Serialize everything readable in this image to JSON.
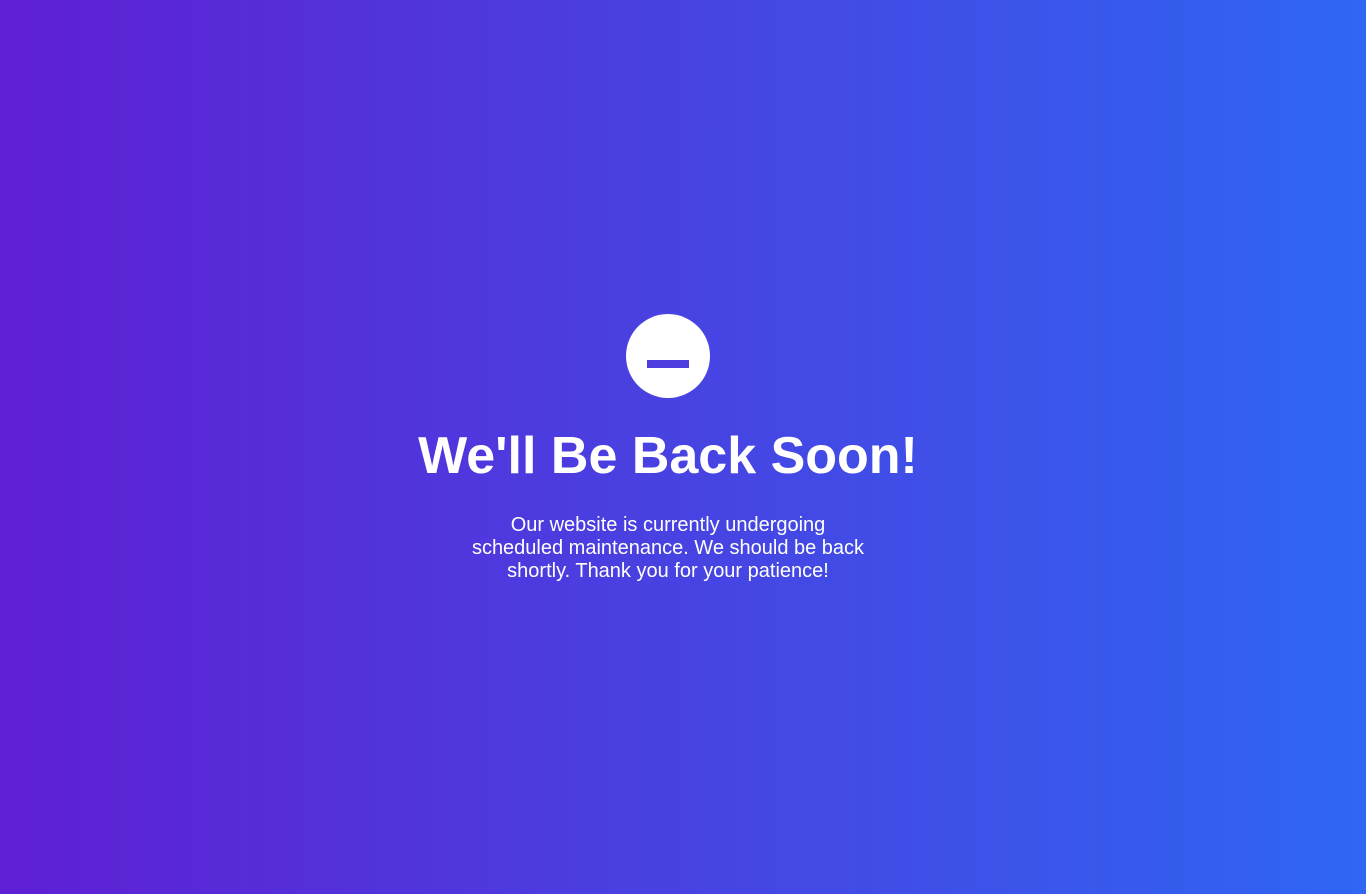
{
  "page": {
    "title": "We'll Be Back Soon!",
    "message": "Our website is currently undergoing scheduled maintenance. We should be back shortly. Thank you for your patience!",
    "icon": "minus-circle-icon"
  },
  "colors": {
    "gradient_start": "#5f1fd4",
    "gradient_mid": "#4a3fe0",
    "gradient_end": "#2f66f3",
    "icon_background": "#ffffff",
    "icon_bar": "#4f3ee0",
    "text": "#ffffff"
  }
}
